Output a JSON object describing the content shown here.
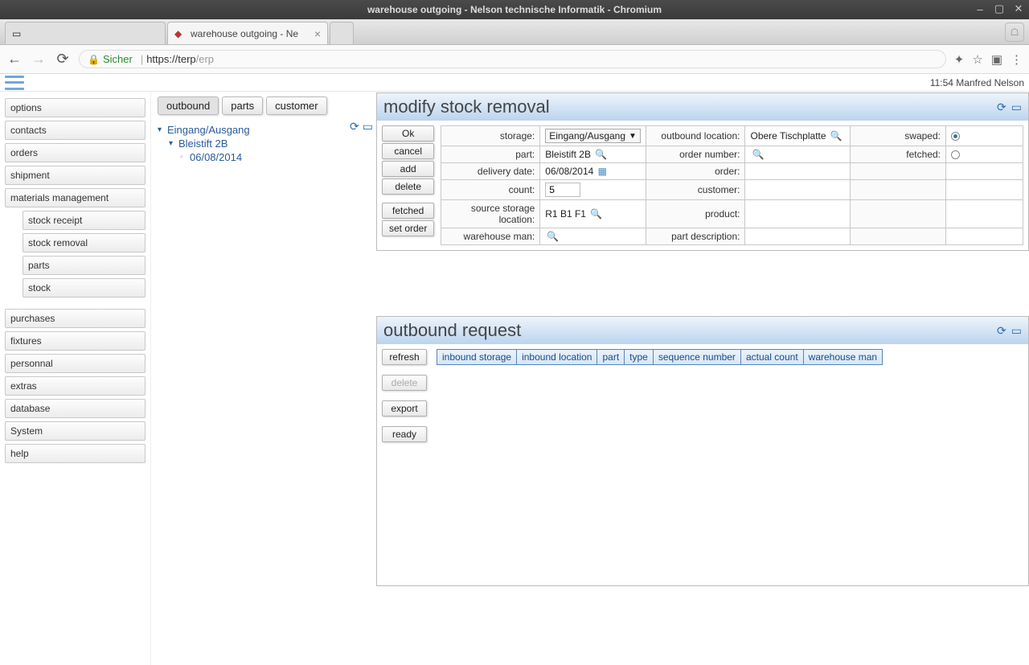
{
  "os": {
    "title": "warehouse outgoing - Nelson technische Informatik - Chromium"
  },
  "browser": {
    "tab1_label": "",
    "tab2_label": "warehouse outgoing - Ne",
    "secure_label": "Sicher",
    "url_domain": "https://terp",
    "url_path": "/erp"
  },
  "topbar": {
    "status": "11:54 Manfred Nelson"
  },
  "sidebar": {
    "items": [
      "options",
      "contacts",
      "orders",
      "shipment",
      "materials management"
    ],
    "sub": [
      "stock receipt",
      "stock removal",
      "parts",
      "stock"
    ],
    "items2": [
      "purchases",
      "fixtures",
      "personnal",
      "extras",
      "database",
      "System",
      "help"
    ]
  },
  "filetabs": {
    "t0": "outbound",
    "t1": "parts",
    "t2": "customer"
  },
  "tree": {
    "n0": "Eingang/Ausgang",
    "n1": "Bleistift 2B",
    "n2": "06/08/2014"
  },
  "panel1": {
    "title": "modify stock removal",
    "buttons": [
      "Ok",
      "cancel",
      "add",
      "delete",
      "fetched",
      "set order"
    ],
    "labels": {
      "storage": "storage:",
      "outbound_location": "outbound location:",
      "swaped": "swaped:",
      "part": "part:",
      "order_number": "order number:",
      "fetched": "fetched:",
      "delivery_date": "delivery date:",
      "order": "order:",
      "count": "count:",
      "customer": "customer:",
      "source_storage_location": "source storage location:",
      "product": "product:",
      "warehouse_man": "warehouse man:",
      "part_description": "part description:"
    },
    "values": {
      "storage": "Eingang/Ausgang",
      "outbound_location": "Obere Tischplatte",
      "part": "Bleistift 2B",
      "delivery_date": "06/08/2014",
      "count": "5",
      "source_storage_location": "R1 B1 F1"
    }
  },
  "panel2": {
    "title": "outbound request",
    "buttons": [
      "refresh",
      "delete",
      "export",
      "ready"
    ],
    "columns": [
      "inbound storage",
      "inbound location",
      "part",
      "type",
      "sequence number",
      "actual count",
      "warehouse man"
    ]
  }
}
